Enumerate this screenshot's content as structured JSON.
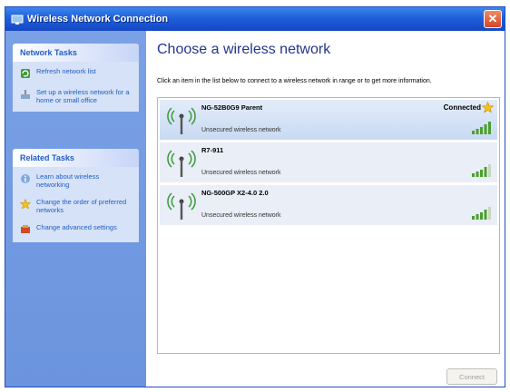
{
  "window": {
    "title": "Wireless Network Connection",
    "close_label": "✕"
  },
  "sidebar": {
    "network_tasks": {
      "header": "Network Tasks",
      "items": [
        {
          "label": "Refresh network list",
          "icon": "refresh-icon"
        },
        {
          "label": "Set up a wireless network for a home or small office",
          "icon": "setup-network-icon"
        }
      ]
    },
    "related_tasks": {
      "header": "Related Tasks",
      "items": [
        {
          "label": "Learn about wireless networking",
          "icon": "info-icon"
        },
        {
          "label": "Change the order of preferred networks",
          "icon": "star-icon"
        },
        {
          "label": "Change advanced settings",
          "icon": "settings-icon"
        }
      ]
    }
  },
  "main": {
    "heading": "Choose a wireless network",
    "instructions": "Click an item in the list below to connect to a wireless network in range or to get more information.",
    "networks": [
      {
        "name": "NG-52B0G9 Parent",
        "security": "Unsecured wireless network",
        "status": "Connected",
        "signal_bars": 5,
        "preferred": true
      },
      {
        "name": "R7-911",
        "security": "Unsecured wireless network",
        "status": "",
        "signal_bars": 4,
        "preferred": false
      },
      {
        "name": "NG-500GP X2-4.0 2.0",
        "security": "Unsecured wireless network",
        "status": "",
        "signal_bars": 4,
        "preferred": false
      }
    ],
    "connect_label": "Connect"
  },
  "colors": {
    "titlebar": "#1f5fd9",
    "sidebar": "#7aa1e6",
    "link": "#215dc6",
    "heading": "#23358c",
    "signal": "#4aa02c"
  }
}
